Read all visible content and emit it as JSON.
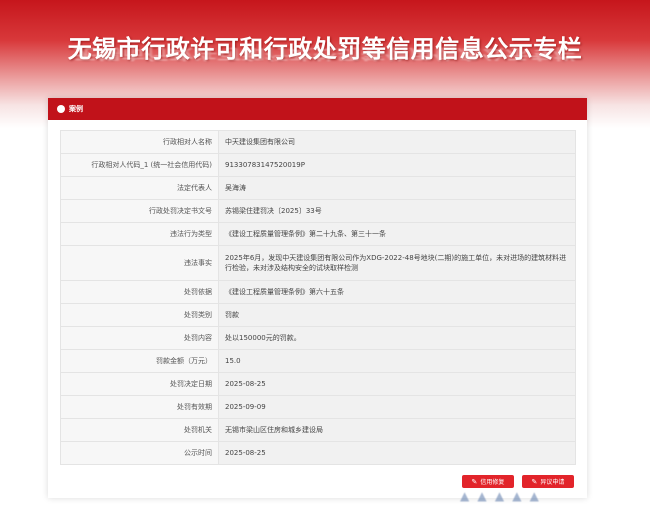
{
  "page_title": "无锡市行政许可和行政处罚等信用信息公示专栏",
  "panel": {
    "header_label": "案例"
  },
  "rows": [
    {
      "label": "行政相对人名称",
      "value": "中天建设集团有限公司"
    },
    {
      "label": "行政相对人代码_1 (统一社会信用代码)",
      "value": "91330783147520019P"
    },
    {
      "label": "法定代表人",
      "value": "吴海涛"
    },
    {
      "label": "行政处罚决定书文号",
      "value": "苏锡梁住建罚决〔2025〕33号"
    },
    {
      "label": "违法行为类型",
      "value": "《建设工程质量管理条例》第二十九条、第三十一条"
    },
    {
      "label": "违法事实",
      "value": "2025年6月，发现中天建设集团有限公司作为XDG-2022-48号地块(二期)的施工单位，未对进场的建筑材料进行检验，未对涉及结构安全的试块取样检测"
    },
    {
      "label": "处罚依据",
      "value": "《建设工程质量管理条例》第六十五条"
    },
    {
      "label": "处罚类别",
      "value": "罚款"
    },
    {
      "label": "处罚内容",
      "value": "处以150000元的罚款。"
    },
    {
      "label": "罚款金额（万元）",
      "value": "15.0"
    },
    {
      "label": "处罚决定日期",
      "value": "2025-08-25"
    },
    {
      "label": "处罚有效期",
      "value": "2025-09-09"
    },
    {
      "label": "处罚机关",
      "value": "无锡市梁山区住房和城乡建设局"
    },
    {
      "label": "公示时间",
      "value": "2025-08-25"
    }
  ],
  "buttons": {
    "first": "信用修复",
    "second": "异议申请"
  },
  "colors": {
    "accent": "#c1121a",
    "button": "#e2242a"
  }
}
